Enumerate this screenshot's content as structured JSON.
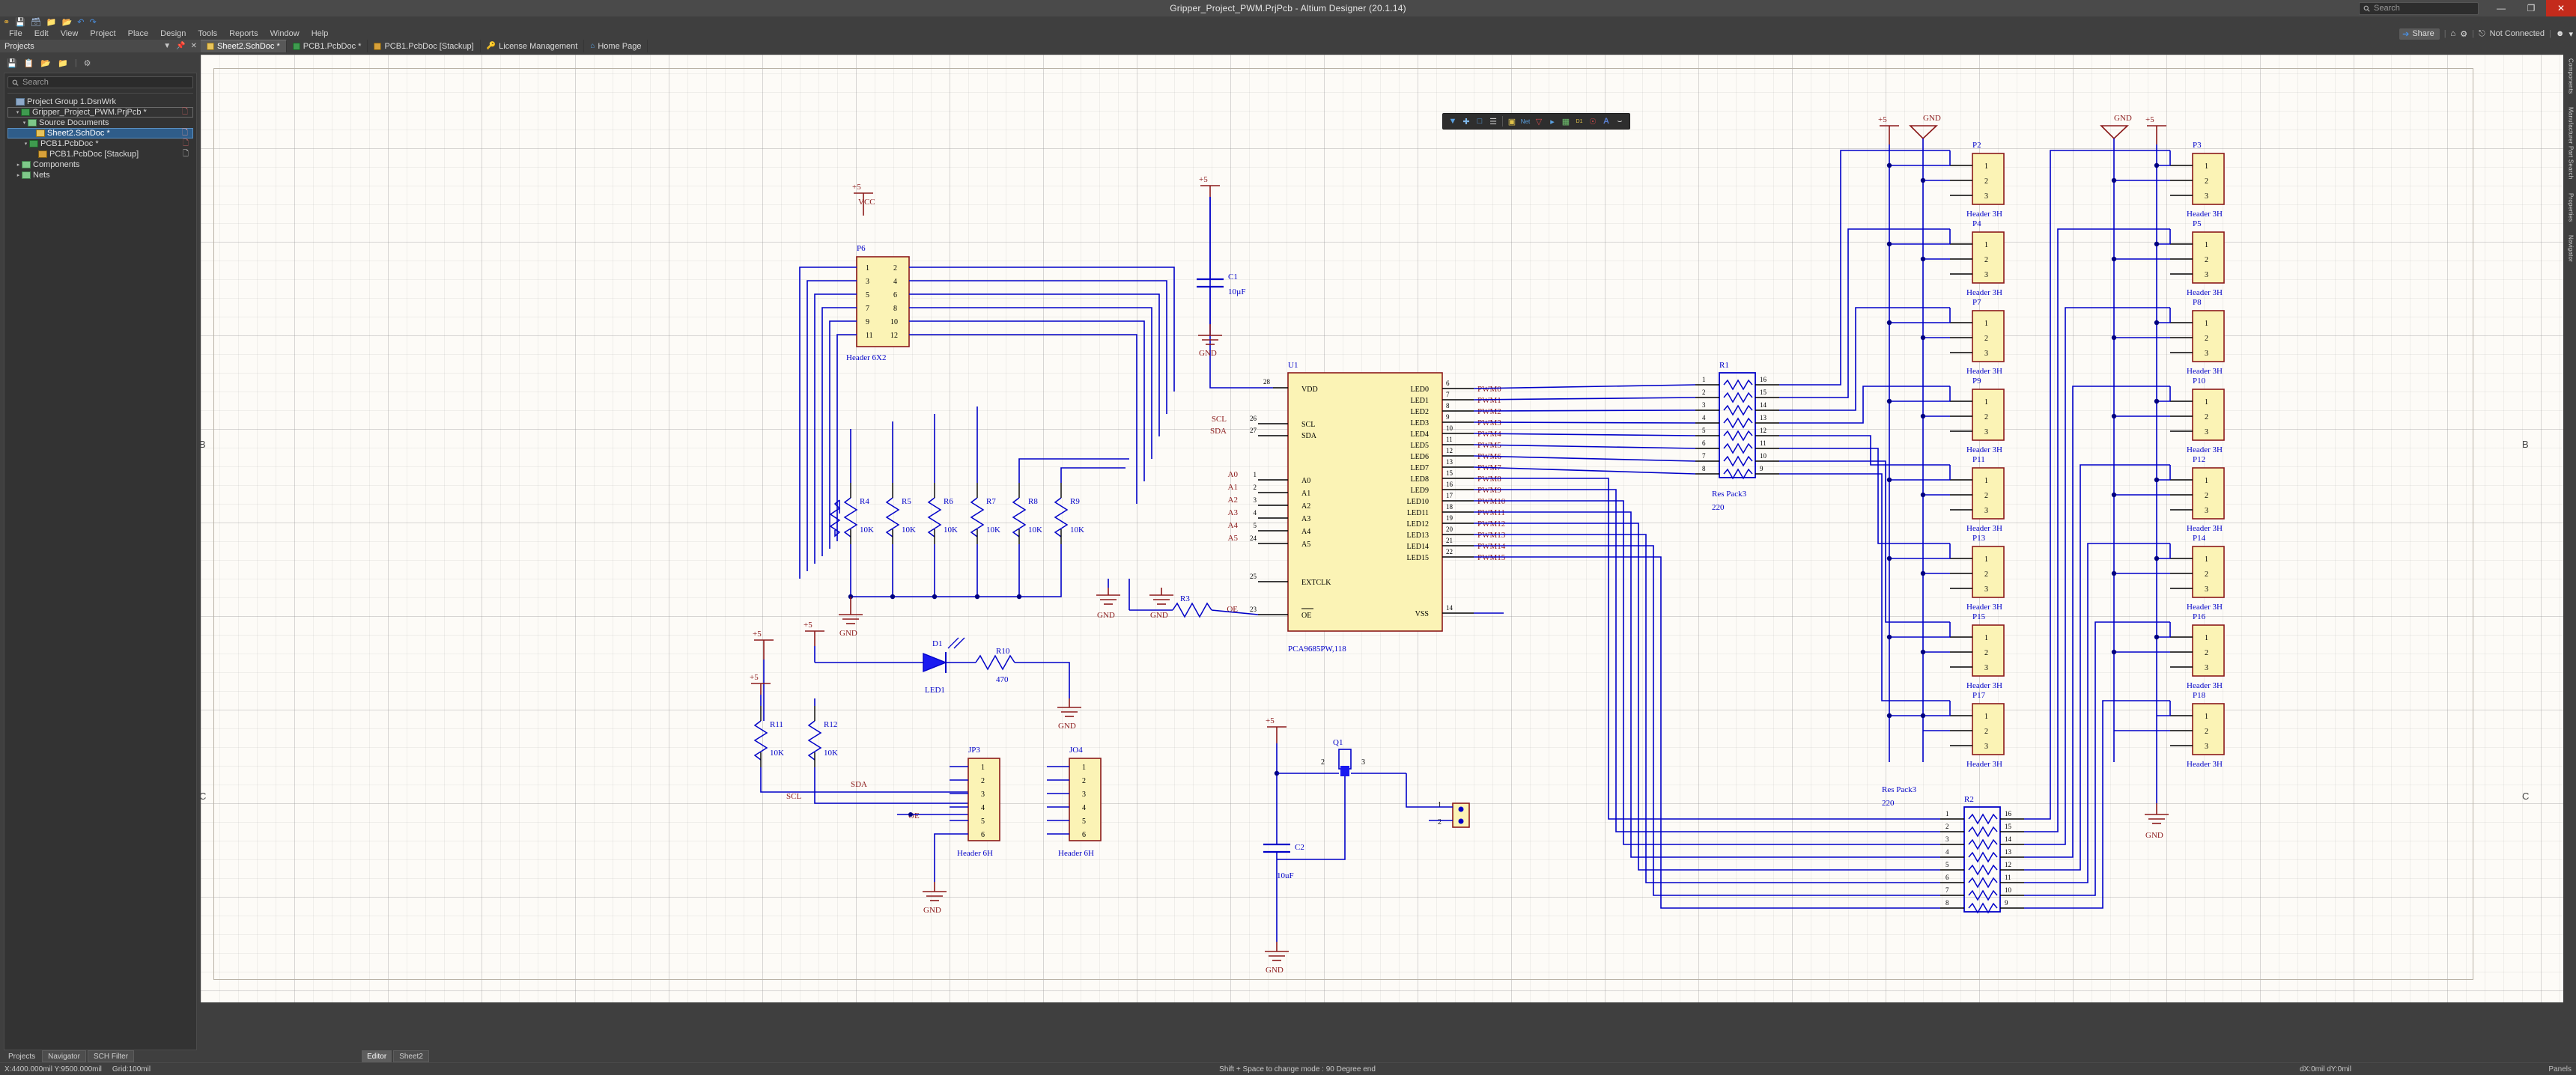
{
  "window": {
    "title": "Gripper_Project_PWM.PrjPcb - Altium Designer (20.1.14)",
    "search_placeholder": "Search",
    "minimize": "—",
    "restore": "❐",
    "close": "✕"
  },
  "menubar": {
    "items": [
      "File",
      "Edit",
      "View",
      "Project",
      "Place",
      "Design",
      "Tools",
      "Reports",
      "Window",
      "Help"
    ],
    "right": {
      "share": "Share",
      "home_icon": "home-icon",
      "settings_icon": "gear-icon",
      "connection_status": "Not Connected",
      "account_icon": "account-icon",
      "chevron": "▾",
      "sep": "|"
    }
  },
  "quick_toolbar": {
    "icons": [
      "altium-logo-icon",
      "save-icon",
      "save-all-icon",
      "open-folder-icon",
      "open-project-icon",
      "undo-icon",
      "redo-icon"
    ]
  },
  "panel": {
    "title": "Projects",
    "header_controls": [
      "▼",
      "📌",
      "✕"
    ],
    "toolbar_icons": [
      "save-icon",
      "copy-icon",
      "open-project-icon",
      "project-options-icon",
      "gear-icon"
    ],
    "search_placeholder": "Search",
    "tree": [
      {
        "label": "Project Group 1.DsnWrk",
        "depth": 0,
        "twist": "",
        "icon": "workspace-icon",
        "state": "normal",
        "mark": ""
      },
      {
        "label": "Gripper_Project_PWM.PrjPcb *",
        "depth": 1,
        "twist": "▾",
        "icon": "project-icon",
        "state": "outlined",
        "mark": "◻"
      },
      {
        "label": "Source Documents",
        "depth": 2,
        "twist": "▾",
        "icon": "folder-icon",
        "state": "normal",
        "mark": ""
      },
      {
        "label": "Sheet2.SchDoc *",
        "depth": 3,
        "twist": "",
        "icon": "schdoc-icon",
        "state": "selected",
        "mark": "◻"
      },
      {
        "label": "PCB1.PcbDoc *",
        "depth": 3,
        "twist": "▾",
        "icon": "pcbdoc-icon",
        "state": "normal",
        "mark": "◻"
      },
      {
        "label": "PCB1.PcbDoc [Stackup]",
        "depth": 4,
        "twist": "",
        "icon": "stackup-icon",
        "state": "normal",
        "mark": "◻"
      },
      {
        "label": "Components",
        "depth": 1,
        "twist": "▸",
        "icon": "folder-icon",
        "state": "normal",
        "mark": ""
      },
      {
        "label": "Nets",
        "depth": 1,
        "twist": "▸",
        "icon": "folder-icon",
        "state": "normal",
        "mark": ""
      }
    ]
  },
  "doctabs": [
    {
      "label": "Sheet2.SchDoc *",
      "icon": "schdoc-icon",
      "active": true
    },
    {
      "label": "PCB1.PcbDoc *",
      "icon": "pcbdoc-icon",
      "active": false
    },
    {
      "label": "PCB1.PcbDoc [Stackup]",
      "icon": "stackup-icon",
      "active": false
    },
    {
      "label": "License Management",
      "icon": "key-icon",
      "active": false
    },
    {
      "label": "Home Page",
      "icon": "home-icon",
      "active": false
    }
  ],
  "schematic_toolbar": {
    "icons": [
      "filter-icon",
      "crosshair-icon",
      "select-area-icon",
      "align-icon",
      "place-part-icon",
      "place-net-label-icon",
      "place-gnd-power-icon",
      "place-port-icon",
      "place-sheet-symbol-icon",
      "place-designator-icon",
      "place-no-erc-icon",
      "place-text-icon",
      "place-arc-icon"
    ]
  },
  "right_rail": {
    "tabs": [
      "Components",
      "Manufacturer Part Search",
      "Properties",
      "Navigator"
    ]
  },
  "bottom_tabs": {
    "panels": [
      "Projects",
      "Navigator",
      "SCH Filter"
    ],
    "editors": [
      "Editor",
      "Sheet2"
    ],
    "active_editor": "Editor"
  },
  "statusbar": {
    "coords": "X:4400.000mil Y:9500.000mil",
    "grid": "Grid:100mil",
    "hint": "Shift + Space to change mode : 90 Degree end",
    "delta": "dX:0mil dY:0mil",
    "panels_label": "Panels"
  },
  "sheet": {
    "zone_labels_left": [
      "B",
      "C"
    ],
    "zone_labels_right": [
      "B",
      "C"
    ]
  },
  "schematic": {
    "ic": {
      "designator": "U1",
      "part": "PCA9685PW,118",
      "left_pins": [
        {
          "name": "VDD",
          "num": "28"
        },
        {
          "name": "SCL",
          "num": "26",
          "net": "SCL"
        },
        {
          "name": "SDA",
          "num": "27",
          "net": "SDA"
        },
        {
          "name": "A0",
          "num": "1",
          "net": "A0"
        },
        {
          "name": "A1",
          "num": "2",
          "net": "A1"
        },
        {
          "name": "A2",
          "num": "3",
          "net": "A2"
        },
        {
          "name": "A3",
          "num": "4",
          "net": "A3"
        },
        {
          "name": "A4",
          "num": "5",
          "net": "A4"
        },
        {
          "name": "A5",
          "num": "24",
          "net": "A5"
        },
        {
          "name": "EXTCLK",
          "num": "25"
        },
        {
          "name": "OE",
          "num": "23",
          "net": "OE"
        }
      ],
      "right_pins": [
        {
          "name": "LED0",
          "num": "6",
          "net": "PWM0"
        },
        {
          "name": "LED1",
          "num": "7",
          "net": "PWM1"
        },
        {
          "name": "LED2",
          "num": "8",
          "net": "PWM2"
        },
        {
          "name": "LED3",
          "num": "9",
          "net": "PWM3"
        },
        {
          "name": "LED4",
          "num": "10",
          "net": "PWM4"
        },
        {
          "name": "LED5",
          "num": "11",
          "net": "PWM5"
        },
        {
          "name": "LED6",
          "num": "12",
          "net": "PWM6"
        },
        {
          "name": "LED7",
          "num": "13",
          "net": "PWM7"
        },
        {
          "name": "LED8",
          "num": "15",
          "net": "PWM8"
        },
        {
          "name": "LED9",
          "num": "16",
          "net": "PWM9"
        },
        {
          "name": "LED10",
          "num": "17",
          "net": "PWM10"
        },
        {
          "name": "LED11",
          "num": "18",
          "net": "PWM11"
        },
        {
          "name": "LED12",
          "num": "19",
          "net": "PWM12"
        },
        {
          "name": "LED13",
          "num": "20",
          "net": "PWM13"
        },
        {
          "name": "LED14",
          "num": "21",
          "net": "PWM14"
        },
        {
          "name": "LED15",
          "num": "22",
          "net": "PWM15"
        },
        {
          "name": "VSS",
          "num": "14"
        }
      ]
    },
    "connector_P6": {
      "designator": "P6",
      "type": "Header 6X2",
      "pins": [
        "1",
        "2",
        "3",
        "4",
        "5",
        "6",
        "7",
        "8",
        "9",
        "10",
        "11",
        "12"
      ]
    },
    "capacitors": [
      {
        "designator": "C1",
        "value": "10uF"
      },
      {
        "designator": "C2",
        "value": "10uF"
      }
    ],
    "pullups": [
      {
        "designator": "R4",
        "value": "10K"
      },
      {
        "designator": "R5",
        "value": "10K"
      },
      {
        "designator": "R6",
        "value": "10K"
      },
      {
        "designator": "R7",
        "value": "10K"
      },
      {
        "designator": "R8",
        "value": "10K"
      },
      {
        "designator": "R9",
        "value": "10K"
      },
      {
        "designator": "R11",
        "value": "10K"
      },
      {
        "designator": "R12",
        "value": "10K"
      }
    ],
    "led": {
      "designator": "D1",
      "name": "LED1",
      "resistor": "R10",
      "resistor_value": "470"
    },
    "r3": {
      "designator": "R3"
    },
    "q1": {
      "designator": "Q1",
      "pins": [
        "1",
        "2",
        "3"
      ]
    },
    "res_packs": [
      {
        "designator": "R1",
        "type": "Res Pack3",
        "value": "220",
        "left_pins": [
          "1",
          "2",
          "3",
          "4",
          "5",
          "6",
          "7",
          "8"
        ],
        "right_pins": [
          "16",
          "15",
          "14",
          "13",
          "12",
          "11",
          "10",
          "9"
        ]
      },
      {
        "designator": "R2",
        "type": "Res Pack3",
        "value": "220",
        "left_pins": [
          "1",
          "2",
          "3",
          "4",
          "5",
          "6",
          "7",
          "8"
        ],
        "right_pins": [
          "16",
          "15",
          "14",
          "13",
          "12",
          "11",
          "10",
          "9"
        ]
      }
    ],
    "headers_3h": [
      "P2",
      "P3",
      "P4",
      "P5",
      "P7",
      "P8",
      "P9",
      "P10",
      "P11",
      "P12",
      "P13",
      "P14",
      "P15",
      "P16",
      "P17",
      "P18"
    ],
    "header_3h_type": "Header 3H",
    "header_3h_pins": [
      "1",
      "2",
      "3"
    ],
    "headers_6h": [
      {
        "designator": "JP3",
        "type": "Header 6H",
        "pins": [
          "1",
          "2",
          "3",
          "4",
          "5",
          "6"
        ]
      },
      {
        "designator": "JO4",
        "type": "Header 6H",
        "pins": [
          "1",
          "2",
          "3",
          "4",
          "5",
          "6"
        ]
      }
    ],
    "power_labels": {
      "vcc": "VCC",
      "p5v": "+5",
      "gnd": "GND"
    },
    "net_labels": [
      "SCL",
      "SDA",
      "OE"
    ]
  }
}
